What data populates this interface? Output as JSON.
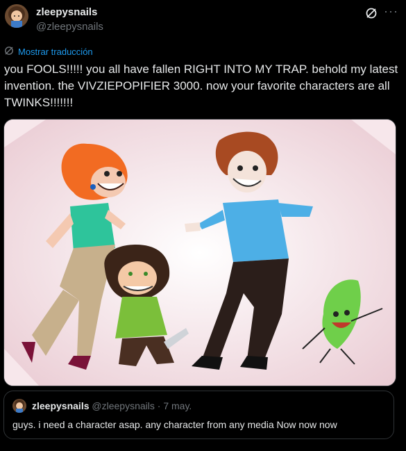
{
  "post": {
    "display_name": "zleepysnails",
    "handle": "@zleepysnails",
    "translate_label": "Mostrar traducción",
    "text": "you FOOLS!!!!! you all have fallen RIGHT INTO MY TRAP. behold my latest invention. the VIVZIEPOPIFIER 3000. now your favorite characters are all TWINKS!!!!!!!",
    "more_label": "···"
  },
  "quote": {
    "display_name": "zleepysnails",
    "handle": "@zleepysnails",
    "separator": " · ",
    "date": "7 may.",
    "text": "guys. i need a character asap. any character from any media Now now now"
  },
  "icons": {
    "grok": "grok-icon",
    "translate": "globe-slash-icon"
  },
  "colors": {
    "background": "#000000",
    "text": "#e7e9ea",
    "muted": "#71767b",
    "link": "#1d9bf0",
    "border": "#2f3336"
  }
}
